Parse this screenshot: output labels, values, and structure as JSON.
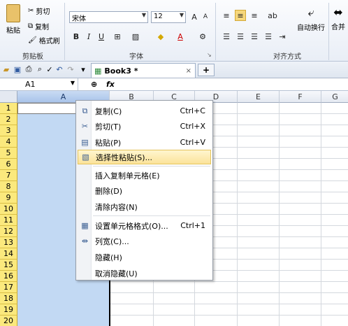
{
  "ribbon": {
    "clipboard": {
      "paste": "粘贴",
      "cut": "剪切",
      "copy": "复制",
      "format_painter": "格式刷",
      "group": "剪贴板"
    },
    "font": {
      "name": "宋体",
      "size": "12",
      "bold": "B",
      "italic": "I",
      "underline": "U",
      "group": "字体"
    },
    "align": {
      "wrap": "自动换行",
      "merge": "合并",
      "group": "对齐方式"
    }
  },
  "tabs": {
    "doc": "Book3 *",
    "close": "×",
    "new": "+"
  },
  "formula": {
    "cell": "A1",
    "fx": "fx"
  },
  "columns": [
    "A",
    "B",
    "C",
    "D",
    "E",
    "F",
    "G"
  ],
  "rows": [
    "1",
    "2",
    "3",
    "4",
    "5",
    "6",
    "7",
    "8",
    "9",
    "10",
    "11",
    "12",
    "13",
    "14",
    "15",
    "16",
    "17",
    "18",
    "19",
    "20"
  ],
  "menu": [
    {
      "label": "复制(C)",
      "shortcut": "Ctrl+C",
      "icon": "copy-icon"
    },
    {
      "label": "剪切(T)",
      "shortcut": "Ctrl+X",
      "icon": "cut-icon"
    },
    {
      "label": "粘贴(P)",
      "shortcut": "Ctrl+V",
      "icon": "paste-icon"
    },
    {
      "label": "选择性粘贴(S)...",
      "shortcut": "",
      "icon": "paste-special-icon"
    },
    {
      "label": "插入复制单元格(E)",
      "shortcut": "",
      "icon": ""
    },
    {
      "label": "删除(D)",
      "shortcut": "",
      "icon": ""
    },
    {
      "label": "清除内容(N)",
      "shortcut": "",
      "icon": ""
    },
    {
      "label": "设置单元格格式(O)...",
      "shortcut": "Ctrl+1",
      "icon": "format-cells-icon"
    },
    {
      "label": "列宽(C)...",
      "shortcut": "",
      "icon": "column-width-icon"
    },
    {
      "label": "隐藏(H)",
      "shortcut": "",
      "icon": ""
    },
    {
      "label": "取消隐藏(U)",
      "shortcut": "",
      "icon": ""
    }
  ],
  "colors": {
    "selection": "#c2d9f3",
    "highlight": "#fbe39a",
    "row_header": "#fbe97d"
  }
}
